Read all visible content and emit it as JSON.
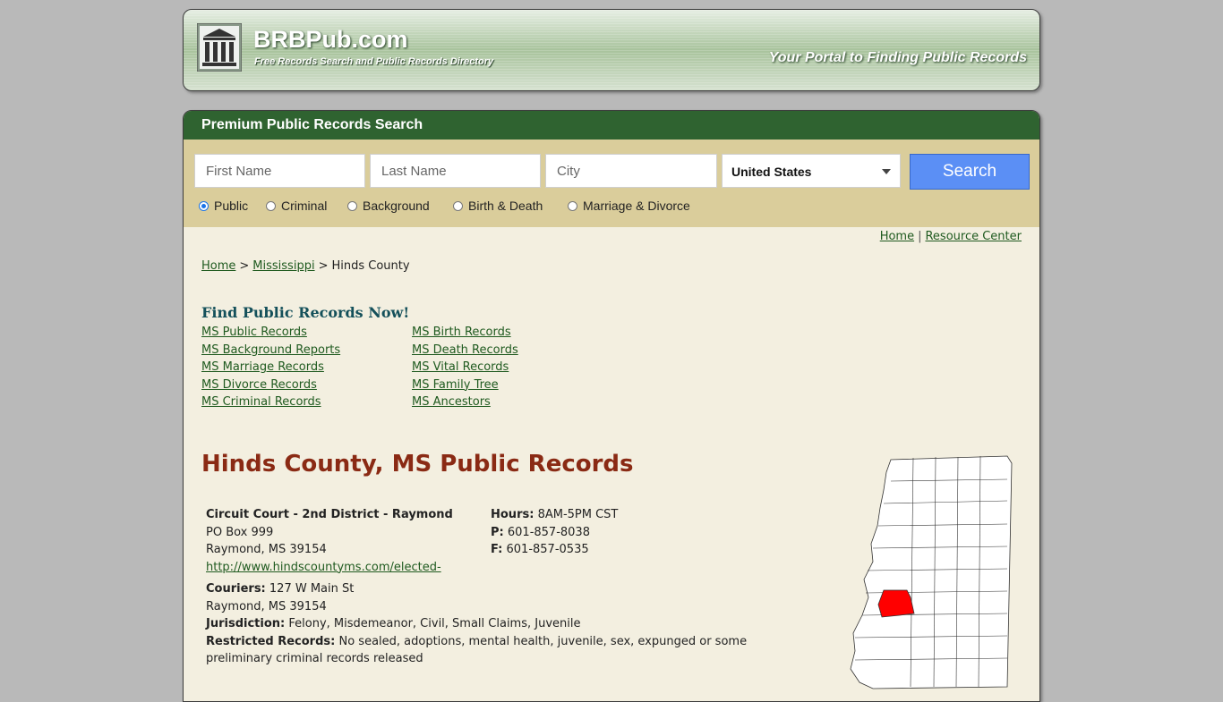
{
  "header": {
    "site_title": "BRBPub.com",
    "site_subtitle": "Free Records Search and Public Records Directory",
    "tagline": "Your Portal to Finding Public Records"
  },
  "search": {
    "heading": "Premium Public Records Search",
    "first_name_placeholder": "First Name",
    "last_name_placeholder": "Last Name",
    "city_placeholder": "City",
    "country_selected": "United States",
    "button_label": "Search",
    "options": [
      "Public",
      "Criminal",
      "Background",
      "Birth & Death",
      "Marriage & Divorce"
    ],
    "selected_option": "Public"
  },
  "toplinks": {
    "home": "Home",
    "resource_center": "Resource Center"
  },
  "breadcrumb": {
    "home": "Home",
    "state": "Mississippi",
    "current": "Hinds County"
  },
  "find": {
    "title": "Find Public Records Now!",
    "left_links": [
      "MS Public Records",
      "MS Background Reports",
      "MS Marriage Records",
      "MS Divorce Records",
      "MS Criminal Records"
    ],
    "right_links": [
      "MS Birth Records",
      "MS Death Records",
      "MS Vital Records",
      "MS Family Tree",
      "MS Ancestors"
    ]
  },
  "page_title": "Hinds County, MS Public Records",
  "office": {
    "name": "Circuit Court - 2nd District - Raymond",
    "address1": "PO Box 999",
    "address2": "Raymond, MS 39154",
    "url": "http://www.hindscountyms.com/elected-",
    "hours_label": "Hours:",
    "hours": "8AM-5PM CST",
    "phone_label": "P:",
    "phone": "601-857-8038",
    "fax_label": "F:",
    "fax": "601-857-0535",
    "couriers_label": "Couriers:",
    "couriers": "127 W Main St",
    "couriers_city": "Raymond, MS 39154",
    "jurisdiction_label": "Jurisdiction:",
    "jurisdiction": "Felony, Misdemeanor, Civil, Small Claims, Juvenile",
    "restricted_label": "Restricted Records:",
    "restricted": "No sealed, adoptions, mental health, juvenile, sex, expunged or some preliminary criminal records released"
  },
  "colors": {
    "accent_green": "#2f6330",
    "title_red": "#8a2a14",
    "highlight_county": "#ff0000",
    "button_blue": "#5b8ff5"
  }
}
